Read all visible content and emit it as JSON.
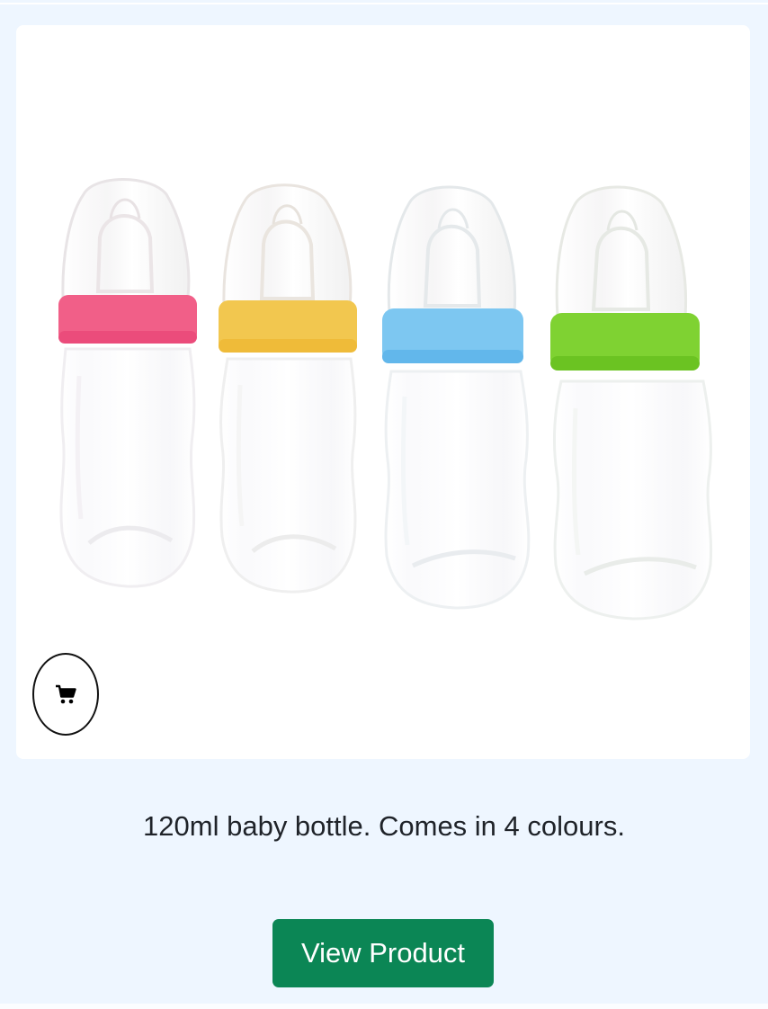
{
  "product": {
    "image": {
      "subject": "four transparent baby bottles",
      "cap_colors": [
        "#f05a87",
        "#f3c34a",
        "#78c2ee",
        "#7ed321"
      ]
    },
    "cart_icon": "shopping-cart-icon",
    "description": "120ml baby bottle. Comes in 4 colours.",
    "view_button_label": "View Product"
  },
  "theme": {
    "page_background": "#eef6ff",
    "button_color": "#0b8655",
    "card_background": "#ffffff"
  }
}
